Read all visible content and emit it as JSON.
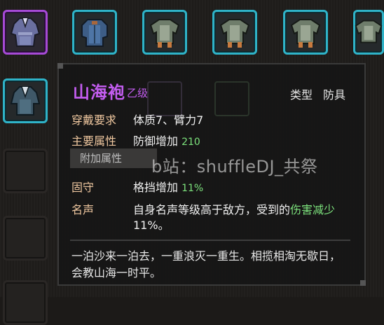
{
  "inventory": {
    "slots": [
      {
        "kind": "purple",
        "icon": "robe-icon"
      },
      {
        "kind": "cyan",
        "icon": "armor-icon"
      },
      {
        "kind": "cyan",
        "icon": "armor-icon"
      },
      {
        "kind": "cyan",
        "icon": "armor-icon"
      },
      {
        "kind": "cyan",
        "icon": "armor-icon"
      },
      {
        "kind": "cyan",
        "icon": "armor-icon"
      }
    ]
  },
  "tooltip": {
    "name": "山海袍",
    "grade": "乙级",
    "type_label": "类型",
    "type_value": "防具",
    "requirements_label": "穿戴要求",
    "requirements_value": "体质7、臂力7",
    "main_attr_label": "主要属性",
    "main_attr_text": "防御增加",
    "main_attr_value": "210",
    "extra_attr_header": "附加属性",
    "extra_attr_label": "固守",
    "extra_attr_text": "格挡增加",
    "extra_attr_value": "11%",
    "fame_label": "名声",
    "fame_line1_a": "自身名声等级高于敌方，受到的",
    "fame_line1_b": "伤害减少",
    "fame_line2": "11%。",
    "flavor_line1": "一泊沙来一泊去，一重浪灭一重生。相揽相淘无歇日，",
    "flavor_line2": "会教山海一时平。"
  },
  "watermark": "b站：shuffleDJ_共祭",
  "colors": {
    "rare_purple": "#c35df0",
    "green_value": "#7de37d",
    "label_tan": "#f0c8a0",
    "slot_cyan": "#2fb3c8",
    "slot_purple": "#a64ad6"
  }
}
